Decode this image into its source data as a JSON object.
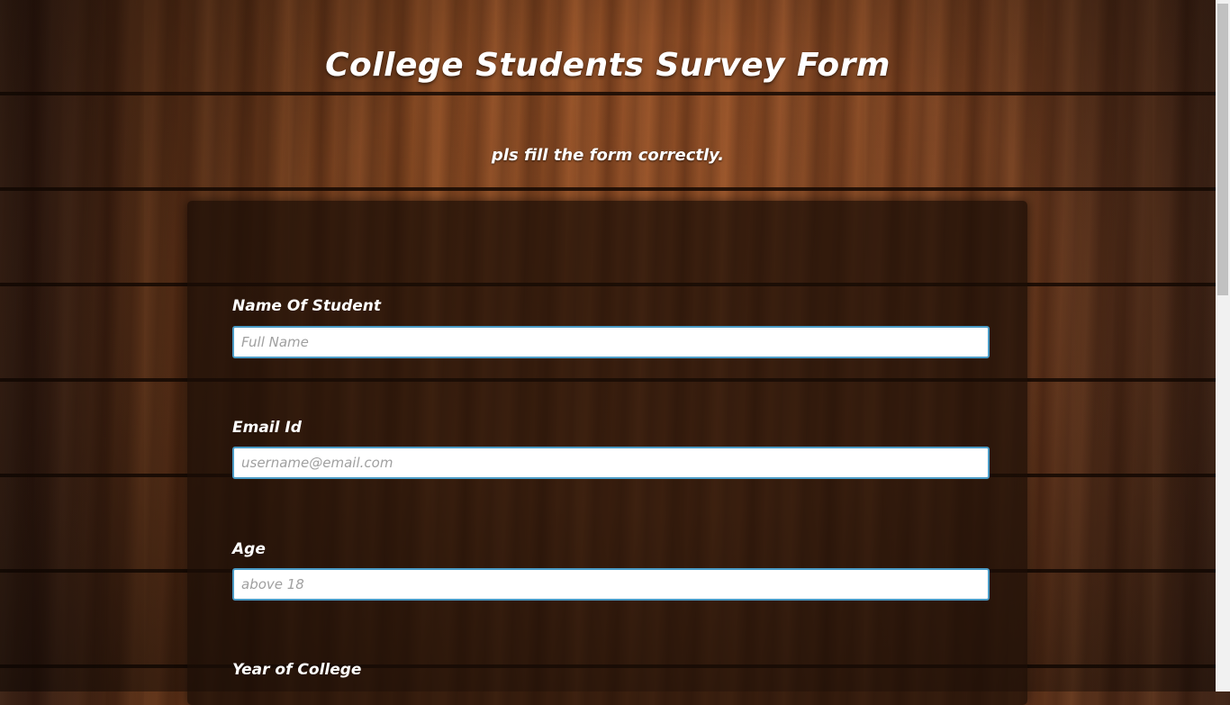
{
  "header": {
    "title": "College Students Survey Form",
    "subtitle": "pls fill the form correctly."
  },
  "form": {
    "name": {
      "label": "Name Of Student",
      "placeholder": "Full Name",
      "value": ""
    },
    "email": {
      "label": "Email Id",
      "placeholder": "username@email.com",
      "value": ""
    },
    "age": {
      "label": "Age",
      "placeholder": "above 18",
      "value": ""
    },
    "year": {
      "label": "Year of College"
    }
  }
}
